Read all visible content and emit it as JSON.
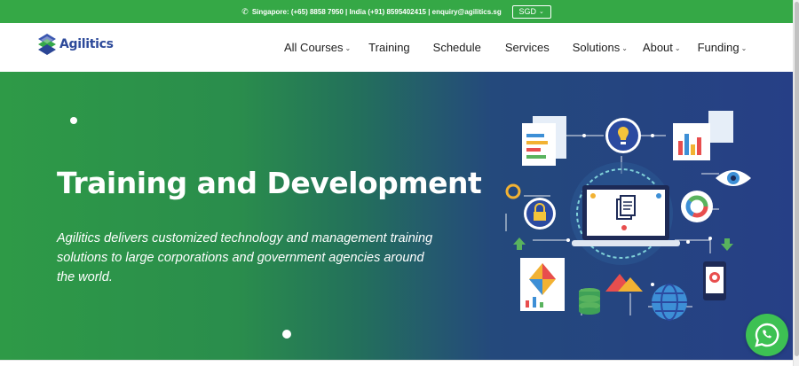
{
  "topbar": {
    "contact": "Singapore: (+65) 8858 7950 | India (+91) 8595402415 | enquiry@agilitics.sg",
    "currency": "SGD"
  },
  "logo": {
    "text": "Agilitics"
  },
  "nav": {
    "items": [
      {
        "label": "All Courses",
        "dropdown": true
      },
      {
        "label": "Training",
        "dropdown": false
      },
      {
        "label": "Schedule",
        "dropdown": false
      },
      {
        "label": "Services",
        "dropdown": false
      },
      {
        "label": "Solutions",
        "dropdown": true
      },
      {
        "label": "About",
        "dropdown": true
      },
      {
        "label": "Funding",
        "dropdown": true
      }
    ]
  },
  "hero": {
    "title": "Training and Development",
    "description": "Agilitics delivers customized technology and management training solutions to large corporations and government agencies around the world."
  },
  "colors": {
    "topbar": "#35a846",
    "brand_blue": "#2d4a9a",
    "hero_green": "#2e9a47",
    "hero_blue": "#263f86",
    "whatsapp": "#3dc153"
  }
}
